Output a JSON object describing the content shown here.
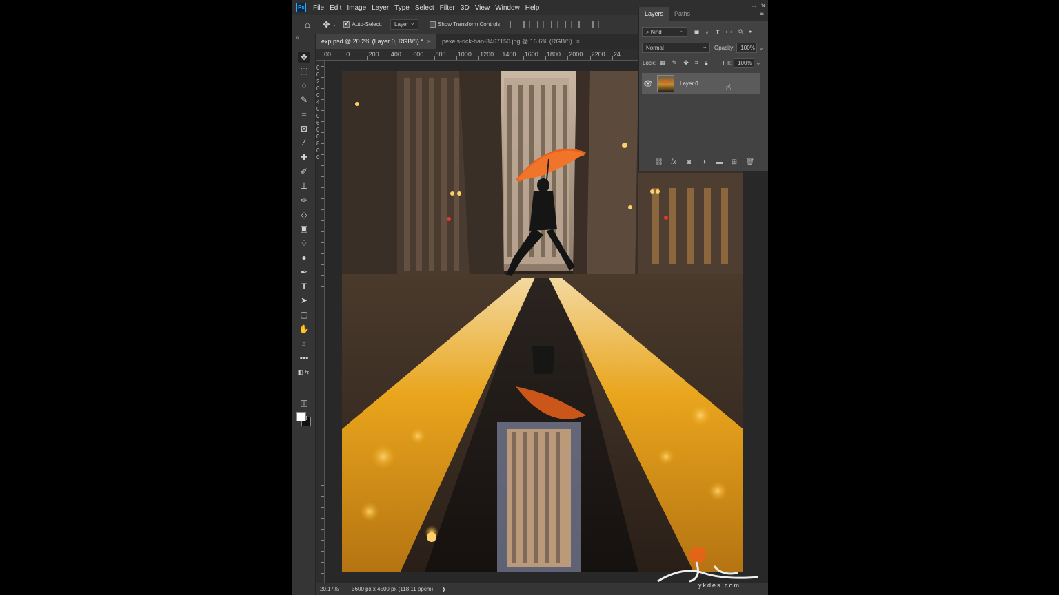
{
  "app": {
    "logo": "Ps",
    "window_controls": {
      "restore": "⇔",
      "close": "✕"
    }
  },
  "menu": [
    "File",
    "Edit",
    "Image",
    "Layer",
    "Type",
    "Select",
    "Filter",
    "3D",
    "View",
    "Window",
    "Help"
  ],
  "options_bar": {
    "home_icon": "home-icon",
    "move_icon": "move-icon",
    "auto_select_label": "Auto-Select:",
    "auto_select_checked": true,
    "auto_select_target": "Layer",
    "show_transform_label": "Show Transform Controls",
    "show_transform_checked": false
  },
  "tabs": [
    {
      "label": "exp.psd @ 20.2% (Layer 0, RGB/8) *",
      "active": true
    },
    {
      "label": "pexels-rick-han-3467150.jpg @ 16.6% (RGB/8)",
      "active": false
    }
  ],
  "ruler_top_labels": [
    "00",
    "0",
    "200",
    "400",
    "600",
    "800",
    "1000",
    "1200",
    "1400",
    "1600",
    "1800",
    "2000",
    "2200",
    "24"
  ],
  "ruler_left_label": "0 0 2 0 0 4 0 0 6 0 0 8 0 0",
  "tools": [
    "move-tool",
    "marquee-tool",
    "lasso-tool",
    "quick-select-tool",
    "crop-tool",
    "frame-tool",
    "eyedropper-tool",
    "healing-tool",
    "brush-tool",
    "stamp-tool",
    "history-brush-tool",
    "eraser-tool",
    "gradient-tool",
    "blur-tool",
    "dodge-tool",
    "pen-tool",
    "type-tool",
    "path-select-tool",
    "shape-tool",
    "hand-tool",
    "zoom-tool",
    "more-tools"
  ],
  "colors": {
    "foreground": "#ffffff",
    "background": "#111111",
    "accent": "#31a8ff",
    "umbrella": "#e8621a",
    "road_glow": "#e9a51c"
  },
  "layers_panel": {
    "tabs": [
      "Layers",
      "Paths"
    ],
    "active_tab": "Layers",
    "filter_kind": "Kind",
    "blend_mode": "Normal",
    "opacity_label": "Opacity:",
    "opacity_value": "100%",
    "lock_label": "Lock:",
    "fill_label": "Fill:",
    "fill_value": "100%",
    "layers": [
      {
        "name": "Layer 0",
        "visible": true,
        "selected": true
      }
    ]
  },
  "status_bar": {
    "zoom": "20.17%",
    "doc_info": "3600 px x 4500 px (118.11 ppcm)",
    "arrow": "❯"
  },
  "watermark": {
    "text": "ykdes.com"
  }
}
